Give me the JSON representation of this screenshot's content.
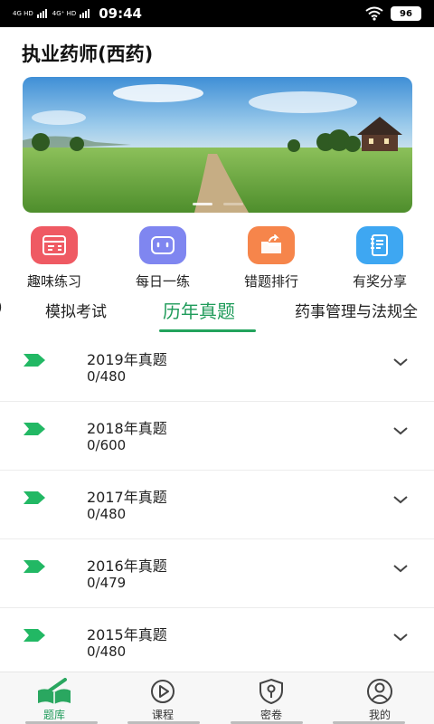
{
  "status": {
    "network_top": "4G HD",
    "network_bottom": "4G⁺ HD",
    "time": "09:44",
    "battery": "96"
  },
  "header": {
    "title": "执业药师(西药)"
  },
  "quick_menu": [
    {
      "label": "趣味练习",
      "icon": "quiz-icon",
      "color": "#ef5a63"
    },
    {
      "label": "每日一练",
      "icon": "daily-practice-icon",
      "color": "#7f86f0"
    },
    {
      "label": "错题排行",
      "icon": "wrong-ranking-icon",
      "color": "#f6854b"
    },
    {
      "label": "有奖分享",
      "icon": "share-reward-icon",
      "color": "#3ea7f2"
    }
  ],
  "tabs": [
    {
      "label": "模拟考试"
    },
    {
      "label": "历年真题",
      "active": true
    },
    {
      "label": "药事管理与法规全"
    }
  ],
  "years": [
    {
      "title": "2019年真题",
      "progress": "0/480"
    },
    {
      "title": "2018年真题",
      "progress": "0/600"
    },
    {
      "title": "2017年真题",
      "progress": "0/480"
    },
    {
      "title": "2016年真题",
      "progress": "0/479"
    },
    {
      "title": "2015年真题",
      "progress": "0/480"
    }
  ],
  "bottom_nav": [
    {
      "label": "题库",
      "icon": "book-pen-icon",
      "active": true
    },
    {
      "label": "课程",
      "icon": "play-circle-icon"
    },
    {
      "label": "密卷",
      "icon": "shield-key-icon"
    },
    {
      "label": "我的",
      "icon": "user-circle-icon"
    }
  ],
  "colors": {
    "accent": "#22a35c",
    "status_bar": "#000000"
  }
}
